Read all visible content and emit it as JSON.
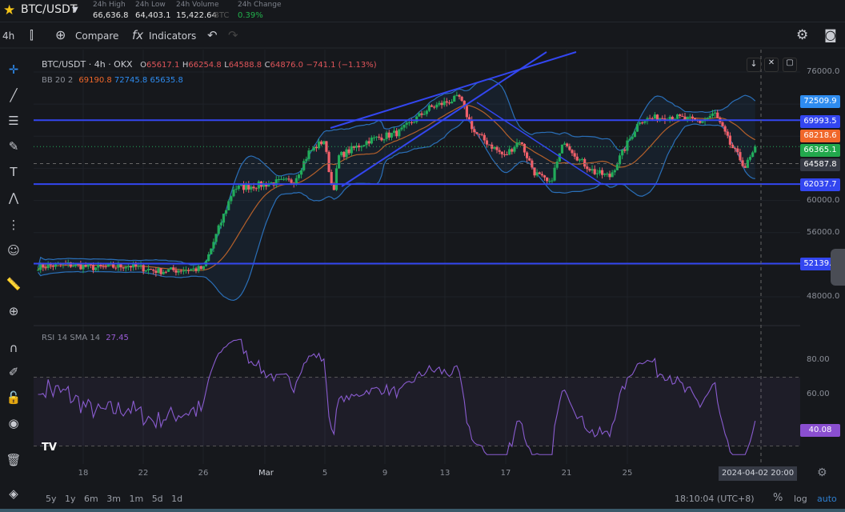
{
  "header": {
    "symbol": "BTC/USDT",
    "star_icon": "star-icon",
    "stats": [
      {
        "label": "24h High",
        "value": "66,636.8"
      },
      {
        "label": "24h Low",
        "value": "64,403.1"
      },
      {
        "label": "24h Volume",
        "value": "15,422.64",
        "unit": "BTC"
      },
      {
        "label": "24h Change",
        "value": "0.39%",
        "color": "#22b14c"
      }
    ]
  },
  "toolbar": {
    "interval": "4h",
    "compare": "Compare",
    "indicators": "Indicators"
  },
  "legend": {
    "title": "BTC/USDT · 4h · OKX",
    "o_label": "O",
    "o": "65617.1",
    "h_label": "H",
    "h": "66254.8",
    "l_label": "L",
    "l": "64588.8",
    "c_label": "C",
    "c": "64876.0",
    "change": "−741.1 (−1.13%)",
    "bb_label": "BB",
    "bb_params": "20 2",
    "bb_mid": "69190.8",
    "bb_up": "72745.8",
    "bb_low": "65635.8"
  },
  "rsi": {
    "label": "RSI",
    "params": "14 SMA 14",
    "value": "27.45",
    "axis": [
      "80.00",
      "60.00"
    ],
    "tag": "40.08"
  },
  "price_axis": [
    "76000.0",
    "60000.0",
    "56000.0",
    "48000.0"
  ],
  "price_tags": [
    {
      "value": "72509.9",
      "color": "#2e8cf0"
    },
    {
      "value": "69993.5",
      "color": "#3346f0"
    },
    {
      "value": "68218.6",
      "color": "#f0672a"
    },
    {
      "value": "66365.1",
      "color": "#22a84c"
    },
    {
      "value": "64587.8",
      "color": "#363a45"
    },
    {
      "value": "62037.7",
      "color": "#3346f0"
    },
    {
      "value": "52139.9",
      "color": "#3346f0"
    }
  ],
  "horizontal_lines": [
    69993.5,
    62037.7,
    52139.9
  ],
  "time_axis": [
    "18",
    "22",
    "26",
    "Mar",
    "5",
    "9",
    "13",
    "17",
    "21",
    "25"
  ],
  "crosshair_time": "2024-04-02  20:00",
  "ranges": [
    "5y",
    "1y",
    "6m",
    "3m",
    "1m",
    "5d",
    "1d"
  ],
  "clock": "18:10:04 (UTC+8)",
  "scale_options": {
    "percent": "%",
    "log": "log",
    "auto": "auto"
  },
  "chart_data": {
    "type": "candlestick",
    "symbol": "BTC/USDT",
    "interval": "4h",
    "ylim": [
      46000,
      78000
    ],
    "close_path": [
      [
        "02-15",
        51800
      ],
      [
        "02-17",
        52000
      ],
      [
        "02-19",
        51600
      ],
      [
        "02-21",
        51900
      ],
      [
        "02-23",
        51200
      ],
      [
        "02-26",
        51500
      ],
      [
        "02-27",
        56500
      ],
      [
        "02-28",
        61500
      ],
      [
        "03-01",
        62000
      ],
      [
        "03-02",
        62300
      ],
      [
        "03-03",
        62400
      ],
      [
        "03-04",
        66000
      ],
      [
        "03-05",
        67500
      ],
      [
        "03-05.6",
        61000
      ],
      [
        "03-06",
        65500
      ],
      [
        "03-08",
        67500
      ],
      [
        "03-10",
        68500
      ],
      [
        "03-12",
        71500
      ],
      [
        "03-14",
        72800
      ],
      [
        "03-15",
        68500
      ],
      [
        "03-17",
        65500
      ],
      [
        "03-18",
        67500
      ],
      [
        "03-19",
        63500
      ],
      [
        "03-20",
        62000
      ],
      [
        "03-21",
        67500
      ],
      [
        "03-22",
        65000
      ],
      [
        "03-23",
        63500
      ],
      [
        "03-24",
        63000
      ],
      [
        "03-25",
        66500
      ],
      [
        "03-26",
        70000
      ],
      [
        "03-28",
        70500
      ],
      [
        "03-30",
        69800
      ],
      [
        "03-31",
        70800
      ],
      [
        "04-01",
        67000
      ],
      [
        "04-02",
        64200
      ],
      [
        "04-02.7",
        66400
      ]
    ]
  }
}
